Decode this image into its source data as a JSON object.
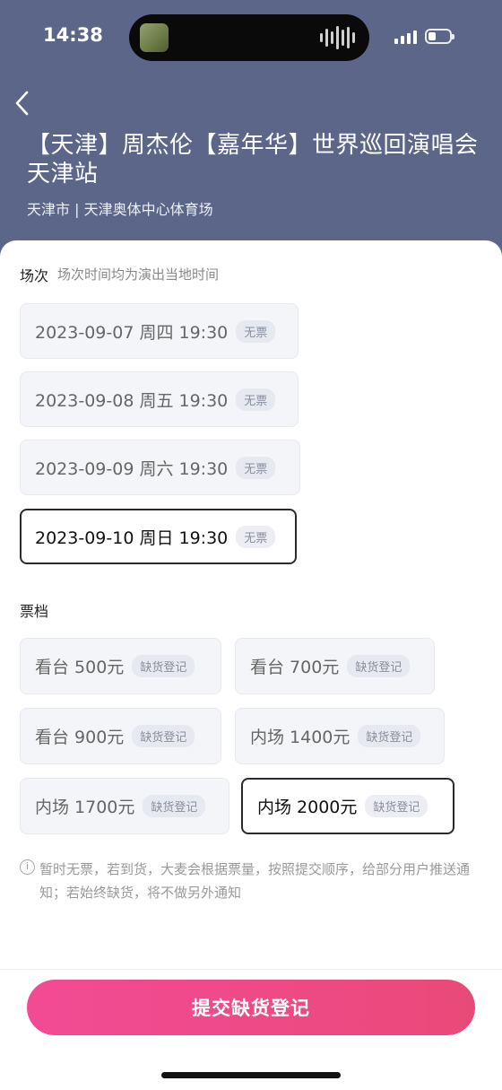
{
  "status_bar": {
    "time": "14:38"
  },
  "header": {
    "title": "【天津】周杰伦【嘉年华】世界巡回演唱会天津站",
    "venue": "天津市 | 天津奥体中心体育场"
  },
  "sessions": {
    "title": "场次",
    "hint": "场次时间均为演出当地时间",
    "items": [
      {
        "label": "2023-09-07 周四 19:30",
        "tag": "无票",
        "selected": false
      },
      {
        "label": "2023-09-08 周五 19:30",
        "tag": "无票",
        "selected": false
      },
      {
        "label": "2023-09-09 周六 19:30",
        "tag": "无票",
        "selected": false
      },
      {
        "label": "2023-09-10 周日 19:30",
        "tag": "无票",
        "selected": true
      }
    ]
  },
  "tickets": {
    "title": "票档",
    "items": [
      {
        "label": "看台 500元",
        "tag": "缺货登记",
        "selected": false
      },
      {
        "label": "看台 700元",
        "tag": "缺货登记",
        "selected": false
      },
      {
        "label": "看台 900元",
        "tag": "缺货登记",
        "selected": false
      },
      {
        "label": "内场 1400元",
        "tag": "缺货登记",
        "selected": false
      },
      {
        "label": "内场 1700元",
        "tag": "缺货登记",
        "selected": false
      },
      {
        "label": "内场 2000元",
        "tag": "缺货登记",
        "selected": true
      }
    ]
  },
  "notice": "暂时无票，若到货，大麦会根据票量，按照提交顺序，给部分用户推送通知；若始终缺货，将不做另外通知",
  "submit_label": "提交缺货登记",
  "colors": {
    "header_bg": "#5b6689",
    "accent_start": "#f24b95",
    "accent_end": "#e84a78"
  }
}
